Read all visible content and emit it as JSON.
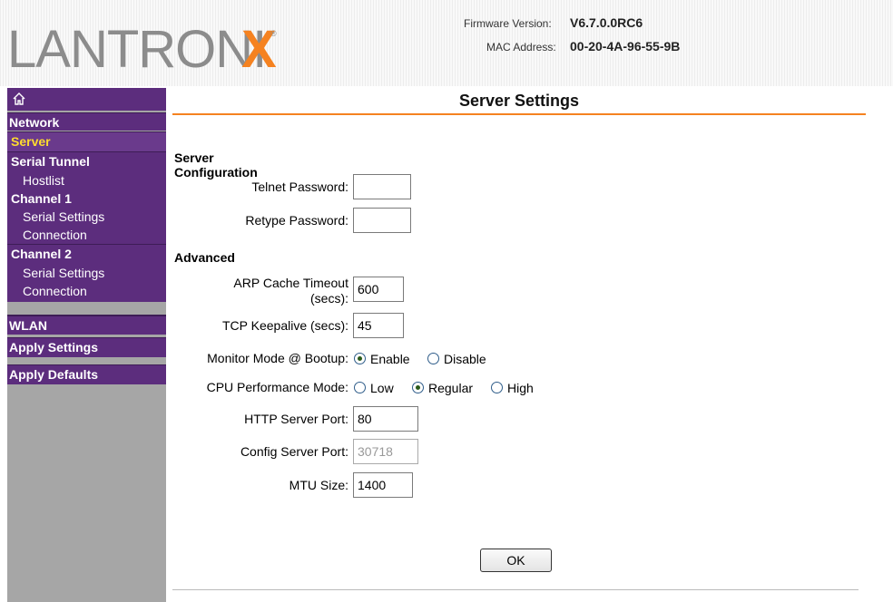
{
  "header": {
    "brand": "LANTRONIX",
    "firmware_label": "Firmware Version:",
    "firmware_value": "V6.7.0.0RC6",
    "mac_label": "MAC Address:",
    "mac_value": "00-20-4A-96-55-9B"
  },
  "sidebar": {
    "home_icon": "home-icon",
    "network": "Network",
    "server": "Server",
    "serial_tunnel": "Serial Tunnel",
    "hostlist": "Hostlist",
    "channel1": "Channel 1",
    "ch1_serial": "Serial Settings",
    "ch1_conn": "Connection",
    "channel2": "Channel 2",
    "ch2_serial": "Serial Settings",
    "ch2_conn": "Connection",
    "wlan": "WLAN",
    "apply_settings": "Apply Settings",
    "apply_defaults": "Apply Defaults"
  },
  "page": {
    "title": "Server Settings"
  },
  "form": {
    "server_config_heading": "Server Configuration",
    "telnet_password_label": "Telnet Password:",
    "telnet_password_value": "",
    "retype_password_label": "Retype Password:",
    "retype_password_value": "",
    "advanced_heading": "Advanced",
    "arp_label_1": "ARP Cache Timeout",
    "arp_label_2": "(secs):",
    "arp_value": "600",
    "tcp_label": "TCP Keepalive (secs):",
    "tcp_value": "45",
    "monitor_label": "Monitor Mode @ Bootup:",
    "monitor_enable": "Enable",
    "monitor_disable": "Disable",
    "cpu_label": "CPU Performance Mode:",
    "cpu_low": "Low",
    "cpu_regular": "Regular",
    "cpu_high": "High",
    "http_label": "HTTP Server Port:",
    "http_value": "80",
    "config_label": "Config Server Port:",
    "config_value": "30718",
    "mtu_label": "MTU Size:",
    "mtu_value": "1400",
    "ok_label": "OK"
  },
  "colors": {
    "accent_orange": "#f58220",
    "nav_purple": "#5c2d7d",
    "active_yellow": "#ffdc2e"
  }
}
